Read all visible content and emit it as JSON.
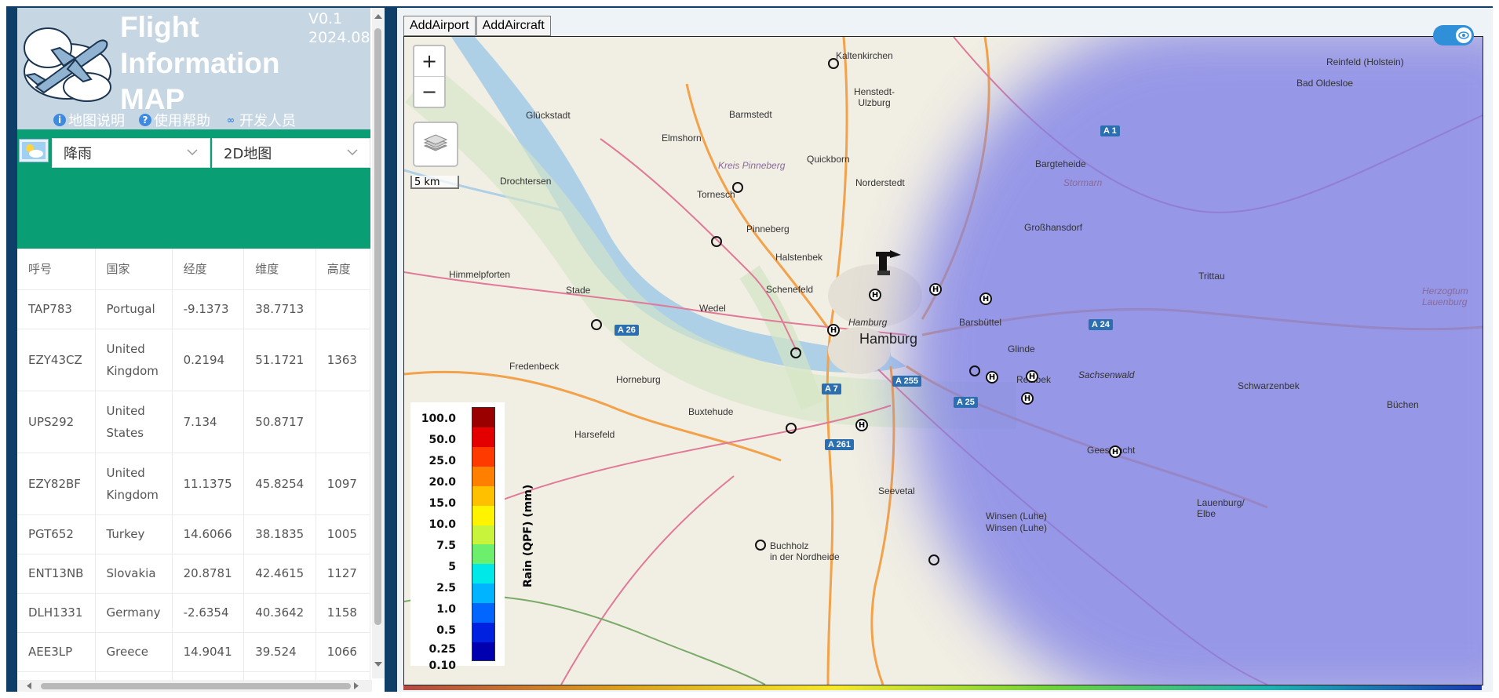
{
  "app": {
    "title_line1": "Flight",
    "title_line2": "Information",
    "title_line3": "MAP",
    "version": "V0.1",
    "date": "2024.08",
    "links": [
      "地图说明",
      "使用帮助",
      "开发人员"
    ]
  },
  "controls": {
    "layer_select": "降雨",
    "view_select": "2D地图"
  },
  "table": {
    "headers": [
      "呼号",
      "国家",
      "经度",
      "维度",
      "高度"
    ],
    "rows": [
      {
        "callsign": "TAP783",
        "country_1": "Portugal",
        "country_2": "",
        "lon": "-9.1373",
        "lat": "38.7713",
        "alt": ""
      },
      {
        "callsign": "EZY43CZ",
        "country_1": "United",
        "country_2": "Kingdom",
        "lon": "0.2194",
        "lat": "51.1721",
        "alt": "1363"
      },
      {
        "callsign": "UPS292",
        "country_1": "United",
        "country_2": "States",
        "lon": "7.134",
        "lat": "50.8717",
        "alt": ""
      },
      {
        "callsign": "EZY82BF",
        "country_1": "United",
        "country_2": "Kingdom",
        "lon": "11.1375",
        "lat": "45.8254",
        "alt": "1097"
      },
      {
        "callsign": "PGT652",
        "country_1": "Turkey",
        "country_2": "",
        "lon": "14.6066",
        "lat": "38.1835",
        "alt": "1005"
      },
      {
        "callsign": "ENT13NB",
        "country_1": "Slovakia",
        "country_2": "",
        "lon": "20.8781",
        "lat": "42.4615",
        "alt": "1127"
      },
      {
        "callsign": "DLH1331",
        "country_1": "Germany",
        "country_2": "",
        "lon": "-2.6354",
        "lat": "40.3642",
        "alt": "1158"
      },
      {
        "callsign": "AEE3LP",
        "country_1": "Greece",
        "country_2": "",
        "lon": "14.9041",
        "lat": "39.524",
        "alt": "1066"
      }
    ]
  },
  "map_toolbar": {
    "add_airport": "AddAirport",
    "add_aircraft": "AddAircraft"
  },
  "map": {
    "zoom_in": "+",
    "zoom_out": "−",
    "scale": "5 km",
    "legend_title": "Rain (QPF) (mm)",
    "legend_values": [
      "100.0",
      "50.0",
      "25.0",
      "20.0",
      "15.0",
      "10.0",
      "7.5",
      "5",
      "2.5",
      "1.0",
      "0.5",
      "0.25",
      "0.10"
    ],
    "legend_colors": [
      "#9b0000",
      "#e50000",
      "#ff3a00",
      "#ff7f00",
      "#ffc000",
      "#fff400",
      "#c8f53c",
      "#6cef6c",
      "#00e8e8",
      "#00b4ff",
      "#0066ff",
      "#0022e0",
      "#0000b0"
    ],
    "places": {
      "hamburg": "Hamburg",
      "glueckstadt": "Glückstadt",
      "barmstedt": "Barmstedt",
      "kaltenkirchen": "Kaltenkirchen",
      "henstedt": "Henstedt-\nUlzburg",
      "reinfeld": "Reinfeld (Holstein)",
      "bad_oldesloe": "Bad Oldesloe",
      "elmshorn": "Elmshorn",
      "quickborn": "Quickborn",
      "kreis_pinneberg": "Kreis Pinneberg",
      "norderstedt": "Norderstedt",
      "bargteheide": "Bargteheide",
      "drochtersen": "Drochtersen",
      "tornesch": "Tornesch",
      "pinneberg": "Pinneberg",
      "grosshansdorf": "Großhansdorf",
      "stormarn": "Stormarn",
      "himmelpforten": "Himmelpforten",
      "halstenbek": "Halstenbek",
      "trittau": "Trittau",
      "stade": "Stade",
      "schenefeld": "Schenefeld",
      "wedel": "Wedel",
      "barsbuettel": "Barsbüttel",
      "herzogtum": "Herzogtum\nLauenburg",
      "glinde": "Glinde",
      "fredenbeck": "Fredenbeck",
      "horneburg": "Horneburg",
      "reinbek": "Reinbek",
      "sachsenwald": "Sachsenwald",
      "schwarzenbek": "Schwarzenbek",
      "buxtehude": "Buxtehude",
      "harsefeld": "Harsefeld",
      "buechen": "Büchen",
      "geesthacht": "Geesthacht",
      "seevetal": "Seevetal",
      "winsen1": "Winsen (Luhe)",
      "winsen2": "Winsen (Luhe)",
      "lauenburg": "Lauenburg/\nElbe",
      "buchholz": "Buchholz\nin der Nordheide",
      "hamburg_small": "Hamburg"
    },
    "roads": [
      "A 1",
      "A 26",
      "A 24",
      "A 7",
      "A 255",
      "A 25",
      "A 261"
    ]
  },
  "colors": {
    "frame": "#0f3f68",
    "header_bg": "#c6d6e2",
    "toolbar_green": "#0a9e74",
    "rain_overlay": "#7d7fe8",
    "toggle": "#2f8fd8"
  }
}
